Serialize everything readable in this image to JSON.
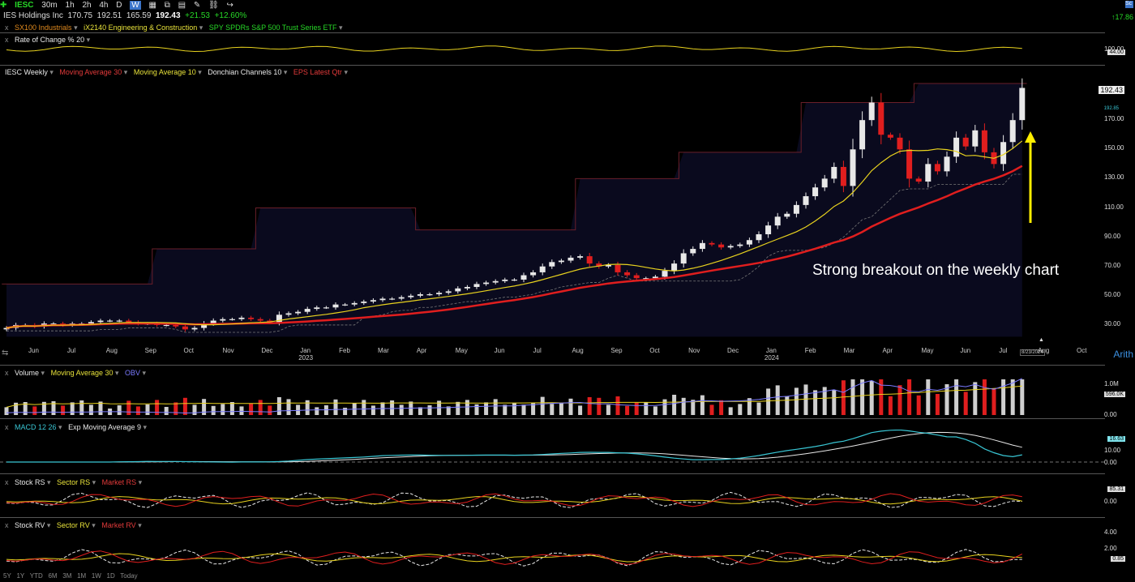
{
  "toolbar": {
    "symbol": "IESC",
    "intervals": [
      "30m",
      "1h",
      "2h",
      "4h",
      "D",
      "W"
    ],
    "selected_interval": "W",
    "right_change": "17.86"
  },
  "quote": {
    "name": "IES Holdings Inc",
    "open": "170.75",
    "high": "192.51",
    "low": "165.59",
    "close": "192.43",
    "change": "+21.53",
    "change_pct": "+12.60%"
  },
  "comparisons": [
    "SX100 Industrials",
    "iX2140 Engineering & Construction",
    "SPY SPDRs S&P 500 Trust Series ETF"
  ],
  "roc_panel": {
    "label": "Rate of Change % 20",
    "ticks": [
      "100.00",
      "44.00"
    ]
  },
  "main_panel": {
    "label": "IESC Weekly",
    "ma30": "Moving Average 30",
    "ma10": "Moving Average 10",
    "donchian": "Donchian Channels 10",
    "eps": "EPS Latest Qtr",
    "y_ticks": [
      "170.00",
      "150.00",
      "130.00",
      "110.00",
      "90.00",
      "70.00",
      "50.00",
      "30.00"
    ],
    "price_tag": "192.43",
    "small_tag": "192.85",
    "annotation": "Strong breakout on the weekly chart",
    "scale_mode": "Arith",
    "date_tag": "8/23/2024"
  },
  "x_axis": {
    "months": [
      "Jun",
      "Jul",
      "Aug",
      "Sep",
      "Oct",
      "Nov",
      "Dec",
      "Jan",
      "Feb",
      "Mar",
      "Apr",
      "May",
      "Jun",
      "Jul",
      "Aug",
      "Sep",
      "Oct",
      "Nov",
      "Dec",
      "Jan",
      "Feb",
      "Mar",
      "Apr",
      "May",
      "Jun",
      "Jul",
      "Aug",
      "Oct"
    ],
    "years": [
      "2023",
      "2024"
    ]
  },
  "volume_panel": {
    "label": "Volume",
    "ma": "Moving Average 30",
    "obv": "OBV",
    "ticks": [
      "1.0M",
      "596.0K",
      "0.00"
    ]
  },
  "macd_panel": {
    "label": "MACD 12 26",
    "signal": "Exp Moving Average 9",
    "ticks": [
      "16.63",
      "10.00",
      "0.00"
    ]
  },
  "rs_panel": {
    "stock": "Stock RS",
    "sector": "Sector RS",
    "market": "Market RS",
    "ticks": [
      "85.31",
      "0.00"
    ]
  },
  "rv_panel": {
    "stock": "Stock RV",
    "sector": "Sector RV",
    "market": "Market RV",
    "ticks": [
      "4.00",
      "2.00",
      "0.85"
    ]
  },
  "ranges": [
    "5Y",
    "1Y",
    "YTD",
    "6M",
    "3M",
    "1M",
    "1W",
    "1D",
    "Today"
  ],
  "colors": {
    "up": "#e8e8e8",
    "down": "#e01e1e",
    "ma30": "#e01e1e",
    "ma10": "#e8d21e",
    "donchian_fill": "#0a0a1e",
    "donchian_line": "#6a1f2a",
    "arrow": "#ffee00",
    "obv": "#7a7aff",
    "macd": "#39c6d4"
  },
  "chart_data": {
    "type": "candlestick",
    "title": "IESC Weekly",
    "ylabel": "",
    "ylim": [
      20,
      200
    ],
    "closes": [
      28,
      30,
      30,
      29,
      31,
      31,
      30,
      31,
      31,
      32,
      33,
      33,
      33,
      32,
      31,
      31,
      30,
      30,
      29,
      27,
      28,
      31,
      33,
      34,
      34,
      35,
      34,
      33,
      32,
      37,
      38,
      39,
      41,
      42,
      42,
      44,
      44,
      45,
      46,
      47,
      48,
      48,
      49,
      50,
      51,
      51,
      52,
      53,
      55,
      56,
      58,
      59,
      60,
      61,
      61,
      64,
      66,
      70,
      73,
      74,
      76,
      77,
      72,
      70,
      71,
      66,
      64,
      62,
      62,
      63,
      67,
      72,
      79,
      82,
      86,
      85,
      83,
      84,
      85,
      88,
      92,
      98,
      104,
      106,
      112,
      118,
      124,
      130,
      138,
      125,
      150,
      170,
      182,
      160,
      158,
      150,
      130,
      128,
      140,
      135,
      145,
      158,
      152,
      163,
      148,
      140,
      155,
      170,
      192
    ],
    "donchian_upper": [
      58,
      58,
      58,
      58,
      58,
      58,
      58,
      58,
      58,
      58,
      58,
      58,
      58,
      58,
      58,
      58,
      82,
      82,
      82,
      82,
      82,
      82,
      82,
      82,
      82,
      82,
      82,
      110,
      110,
      110,
      110,
      110,
      110,
      110,
      110,
      110,
      110,
      110,
      110,
      110,
      110,
      110,
      110,
      110,
      95,
      95,
      95,
      95,
      95,
      95,
      95,
      95,
      95,
      95,
      95,
      95,
      95,
      95,
      95,
      95,
      95,
      130,
      130,
      130,
      130,
      130,
      130,
      130,
      130,
      130,
      130,
      130,
      148,
      148,
      148,
      148,
      148,
      148,
      148,
      148,
      148,
      148,
      148,
      148,
      148,
      182,
      182,
      182,
      182,
      182,
      182,
      182,
      182,
      182,
      182,
      182,
      182,
      195,
      195,
      195,
      195,
      195,
      195,
      195,
      195,
      195,
      195,
      195,
      195
    ]
  }
}
